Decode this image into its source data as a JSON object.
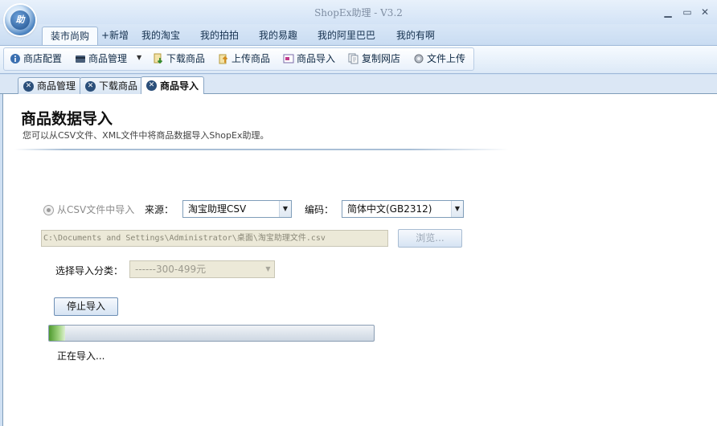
{
  "window": {
    "title": "ShopEx助理 - V3.2",
    "logo_text": "助"
  },
  "menu": {
    "tabs": [
      {
        "label": "装市尚购",
        "active": true
      },
      {
        "label": "+新增"
      },
      {
        "label": "我的淘宝"
      },
      {
        "label": "我的拍拍"
      },
      {
        "label": "我的易趣"
      },
      {
        "label": "我的阿里巴巴"
      },
      {
        "label": "我的有啊"
      }
    ]
  },
  "toolbar": {
    "items": [
      {
        "label": "商店配置",
        "icon": "info-icon"
      },
      {
        "label": "商品管理",
        "icon": "card-icon",
        "has_dropdown": true
      },
      {
        "label": "下载商品",
        "icon": "download-icon"
      },
      {
        "label": "上传商品",
        "icon": "upload-icon"
      },
      {
        "label": "商品导入",
        "icon": "import-icon"
      },
      {
        "label": "复制网店",
        "icon": "copy-icon"
      },
      {
        "label": "文件上传",
        "icon": "gear-icon"
      }
    ]
  },
  "doc_tabs": [
    {
      "label": "商品管理"
    },
    {
      "label": "下载商品"
    },
    {
      "label": "商品导入",
      "active": true
    }
  ],
  "page": {
    "title": "商品数据导入",
    "subtitle": "您可以从CSV文件、XML文件中将商品数据导入ShopEx助理。"
  },
  "form": {
    "radio_label": "从CSV文件中导入",
    "source_label": "来源：",
    "source_value": "淘宝助理CSV",
    "encoding_label": "编码：",
    "encoding_value": "简体中文(GB2312)",
    "file_path": "C:\\Documents and Settings\\Administrator\\桌面\\淘宝助理文件.csv",
    "browse_label": "浏览...",
    "category_label": "选择导入分类：",
    "category_value": "------300-499元",
    "stop_label": "停止导入"
  },
  "progress": {
    "value_percent": 5,
    "status": "正在导入..."
  },
  "colors": {
    "accent": "#4f86c2",
    "progress": "#7cc05a"
  }
}
